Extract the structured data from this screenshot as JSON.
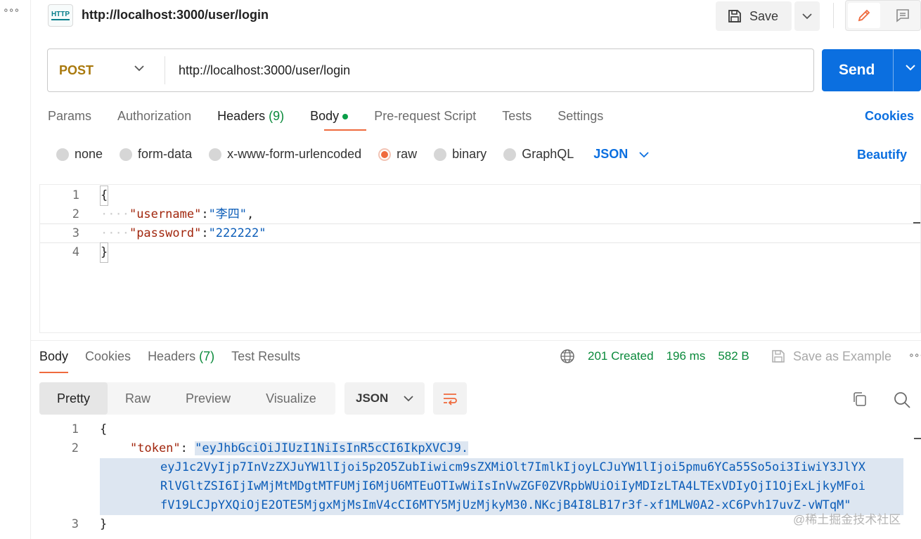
{
  "left_rail": {
    "more": "∘∘∘"
  },
  "header": {
    "badge": "HTTP",
    "title": "http://localhost:3000/user/login",
    "save_label": "Save"
  },
  "request": {
    "method": "POST",
    "url": "http://localhost:3000/user/login",
    "send_label": "Send"
  },
  "request_tabs": [
    {
      "label": "Params"
    },
    {
      "label": "Authorization"
    },
    {
      "label": "Headers",
      "count": "(9)"
    },
    {
      "label": "Body"
    },
    {
      "label": "Pre-request Script"
    },
    {
      "label": "Tests"
    },
    {
      "label": "Settings"
    }
  ],
  "cookies_label": "Cookies",
  "body_types": [
    "none",
    "form-data",
    "x-www-form-urlencoded",
    "raw",
    "binary",
    "GraphQL"
  ],
  "body_format": "JSON",
  "beautify_label": "Beautify",
  "request_body": {
    "line_numbers": [
      "1",
      "2",
      "3",
      "4"
    ],
    "open_brace": "{",
    "indent": "····",
    "username_key": "\"username\"",
    "username_value": "\"李四\"",
    "password_key": "\"password\"",
    "password_value": "\"222222\"",
    "close_brace": "}",
    "colon": ":",
    "comma": ","
  },
  "response_tabs": [
    {
      "label": "Body"
    },
    {
      "label": "Cookies"
    },
    {
      "label": "Headers",
      "count": "(7)"
    },
    {
      "label": "Test Results"
    }
  ],
  "response_status": {
    "status": "201 Created",
    "time": "196 ms",
    "size": "582 B",
    "save_example": "Save as Example",
    "more": "∘∘∘"
  },
  "view_tabs": [
    "Pretty",
    "Raw",
    "Preview",
    "Visualize"
  ],
  "response_format": "JSON",
  "response_body": {
    "line_numbers": [
      "1",
      "2",
      "3"
    ],
    "open_brace": "{",
    "token_key": "\"token\"",
    "colon": ":",
    "token_lines": [
      "\"eyJhbGciOiJIUzI1NiIsInR5cCI6IkpXVCJ9.",
      "eyJ1c2VyIjp7InVzZXJuYW1lIjoi5p2O5ZubIiwicm9sZXMiOlt7ImlkIjoyLCJuYW1lIjoi5pmu6YCa55So5oi3IiwiY3JlYX",
      "RlVGltZSI6IjIwMjMtMDgtMTFUMjI6MjU6MTEuOTIwWiIsInVwZGF0ZVRpbWUiOiIyMDIzLTA4LTExVDIyOjI1OjExLjkyMFoi",
      "fV19LCJpYXQiOjE2OTE5MjgxMjMsImV4cCI6MTY5MjUzMjkyM30.NKcjB4I8LB17r3f-xf1MLW0A2-xC6Pvh17uvZ-vWTqM\""
    ],
    "close_brace": "}"
  },
  "watermark": "@稀土掘金技术社区"
}
